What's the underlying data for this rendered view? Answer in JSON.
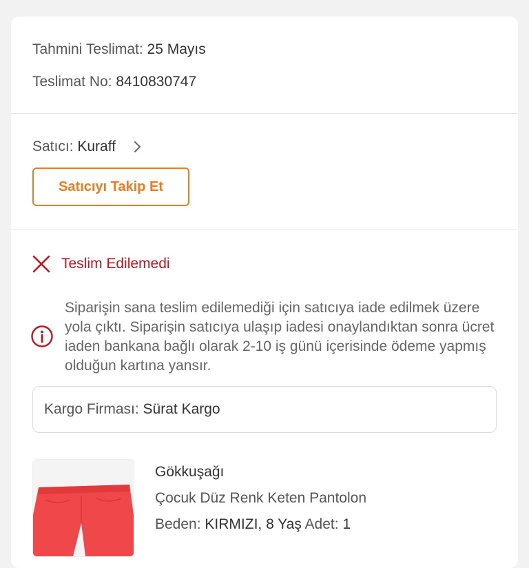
{
  "delivery": {
    "estimated_label": "Tahmini Teslimat:",
    "estimated_value": "25 Mayıs",
    "number_label": "Teslimat No:",
    "number_value": "8410830747"
  },
  "seller": {
    "label": "Satıcı:",
    "name": "Kuraff",
    "follow_button": "Satıcıyı Takip Et"
  },
  "status": {
    "text": "Teslim Edilemedi",
    "info": "Siparişin sana teslim edilemediği için satıcıya iade edilmek üzere yola çıktı. Siparişin satıcıya ulaşıp iadesi onaylandıktan sonra ücret iaden bankana bağlı olarak 2-10 iş günü içerisinde ödeme yapmış olduğun kartına yansır."
  },
  "cargo": {
    "label": "Kargo Firması:",
    "value": "Sürat Kargo"
  },
  "product": {
    "brand": "Gökkuşağı",
    "name": "Çocuk Düz Renk Keten Pantolon",
    "size_label": "Beden:",
    "size_value": "KIRMIZI, 8 Yaş",
    "qty_label": "Adet:",
    "qty_value": "1"
  },
  "colors": {
    "accent": "#f27a1a",
    "error": "#c0161e",
    "product_fabric": "#f0484a"
  },
  "icons": {
    "seller_chevron": "chevron-right-icon",
    "status": "close-icon",
    "info": "info-circle-icon"
  }
}
